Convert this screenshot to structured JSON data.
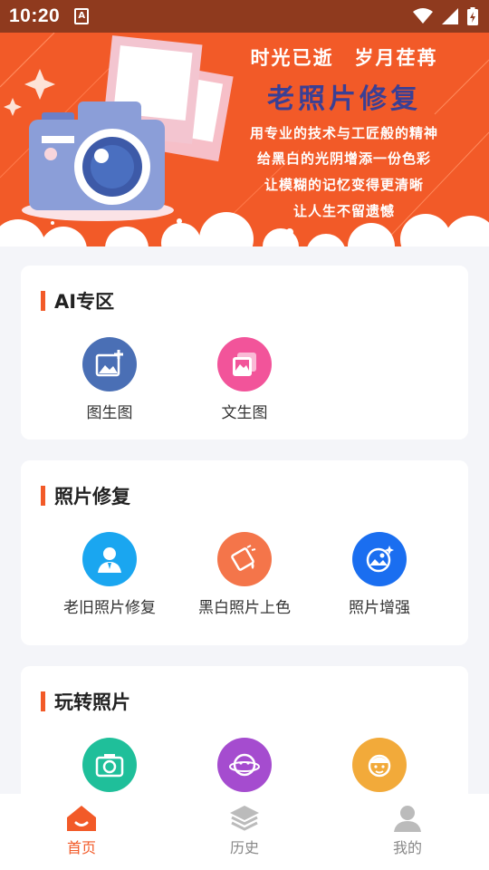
{
  "status_bar": {
    "time": "10:20",
    "notification_icon": "a-notification-icon",
    "icons": [
      "wifi-icon",
      "signal-icon",
      "battery-icon"
    ]
  },
  "banner": {
    "tagline": "时光已逝　岁月荏苒",
    "title": "老照片修复",
    "lines": [
      "用专业的技术与工匠般的精神",
      "给黑白的光阴增添一份色彩",
      "让模糊的记忆变得更清晰",
      "让人生不留遗憾"
    ]
  },
  "sections": {
    "ai": {
      "title": "AI专区",
      "items": [
        {
          "label": "图生图",
          "icon": "image-add-icon",
          "color": "#4a6fb5"
        },
        {
          "label": "文生图",
          "icon": "photo-gallery-icon",
          "color": "#f2549a"
        }
      ]
    },
    "repair": {
      "title": "照片修复",
      "items": [
        {
          "label": "老旧照片修复",
          "icon": "portrait-icon",
          "color": "#1aa6f0"
        },
        {
          "label": "黑白照片上色",
          "icon": "paint-bucket-icon",
          "color": "#f4754a"
        },
        {
          "label": "照片增强",
          "icon": "enhance-image-icon",
          "color": "#1a6ef0"
        }
      ]
    },
    "fun": {
      "title": "玩转照片",
      "items": [
        {
          "label": "",
          "icon": "camera-icon",
          "color": "#1fbf9a"
        },
        {
          "label": "",
          "icon": "face-planet-icon",
          "color": "#a54ccf"
        },
        {
          "label": "",
          "icon": "avatar-face-icon",
          "color": "#f2aa3a"
        }
      ]
    }
  },
  "bottom_nav": [
    {
      "label": "首页",
      "icon": "home-icon",
      "active": true
    },
    {
      "label": "历史",
      "icon": "layers-icon",
      "active": false
    },
    {
      "label": "我的",
      "icon": "user-icon",
      "active": false
    }
  ],
  "colors": {
    "accent": "#f25a28",
    "status_bar": "#8f3a1e",
    "banner_title": "#3a3f94"
  }
}
